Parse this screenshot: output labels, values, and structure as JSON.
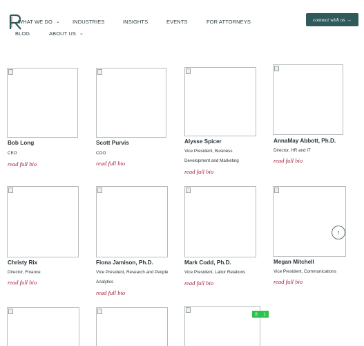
{
  "nav": {
    "row1": [
      "WHAT WE DO",
      "INDUSTRIES",
      "INSIGHTS",
      "EVENTS",
      "FOR ATTORNEYS"
    ],
    "row2": [
      "BLOG",
      "ABOUT US"
    ],
    "cta": "connect with us",
    "cta_arrow": "→"
  },
  "team": [
    {
      "name": "Bob Long",
      "title": "CEO",
      "bio_label": "read full bio"
    },
    {
      "name": "Scott Purvis",
      "title": "COO",
      "bio_label": "read full bio"
    },
    {
      "name": "Alysse Spicer",
      "title": "Vice President, Business Development and Marketing",
      "bio_label": "read full bio"
    },
    {
      "name": "AnnaMay Abbott, Ph.D.",
      "title": "Director, HR and IT",
      "bio_label": "read full bio"
    },
    {
      "name": "Christy Rix",
      "title": "Director, Finance",
      "bio_label": "read full bio"
    },
    {
      "name": "Fiona Jamison, Ph.D.",
      "title": "Vice President, Research and People Analytics",
      "bio_label": "read full bio"
    },
    {
      "name": "Mark Codd, Ph.D.",
      "title": "Vice President, Labor Relations",
      "bio_label": "read full bio"
    },
    {
      "name": "Megan Mitchell",
      "title": "Vice President, Communications",
      "bio_label": "read full bio"
    }
  ],
  "widgets": {
    "scroll_top_icon": "arrow-up-icon",
    "badge_left": "0",
    "badge_right": "1"
  },
  "colors": {
    "accent": "#2f5a5b",
    "link": "#a31f3b",
    "badge": "#2fc14d"
  }
}
